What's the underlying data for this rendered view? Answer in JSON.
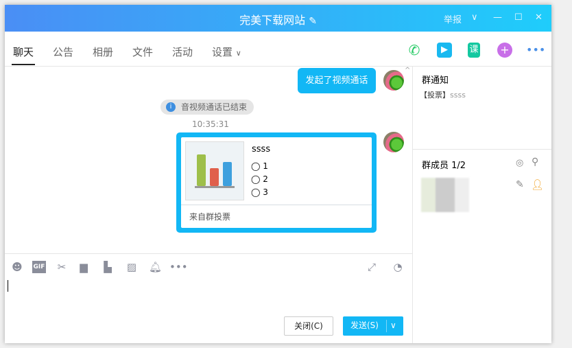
{
  "window": {
    "title": "完美下载网站",
    "report": "举报"
  },
  "tabs": [
    "聊天",
    "公告",
    "相册",
    "文件",
    "活动",
    "设置"
  ],
  "toolbar_icons": [
    "phone-icon",
    "video-call-icon",
    "course-icon",
    "add-app-icon",
    "more-icon"
  ],
  "chat": {
    "msg1": "发起了视频通话",
    "notice": "音视频通话已结束",
    "time": "10:35:31",
    "vote": {
      "title": "ssss",
      "options": [
        "1",
        "2",
        "3"
      ],
      "footer": "来自群投票"
    },
    "chart_colors": [
      "#9ebf4a",
      "#e0604c",
      "#3ea0de"
    ]
  },
  "input": {
    "close": "关闭(C)",
    "send": "发送(S)"
  },
  "right": {
    "notice_title": "群通知",
    "notice_tag": "【投票】",
    "notice_text": "ssss",
    "members_title": "群成员 1/2"
  }
}
